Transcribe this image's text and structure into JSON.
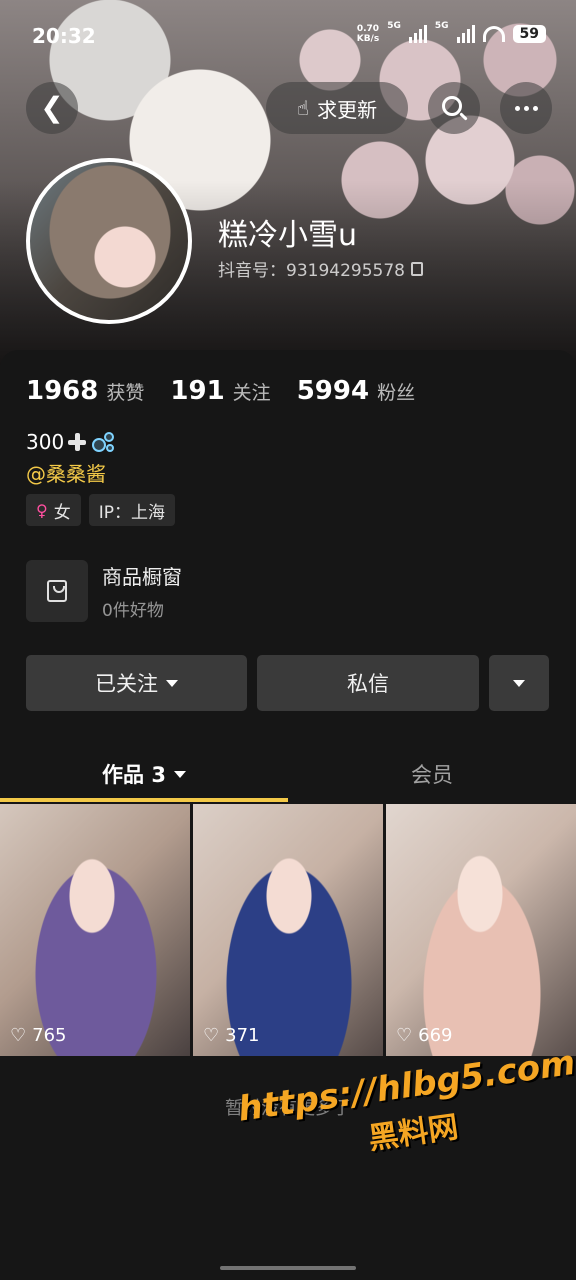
{
  "status_bar": {
    "time": "20:32",
    "net_speed_value": "0.70",
    "net_speed_unit": "KB/s",
    "signal_1": "5G",
    "signal_2": "5G",
    "battery": "59"
  },
  "header": {
    "update_label": "求更新",
    "icons": [
      "back-icon",
      "hand-pointing-icon",
      "search-icon",
      "more-icon"
    ]
  },
  "profile": {
    "nickname": "糕冷小雪u",
    "douyin_id": "抖音号：93194295578",
    "stats": [
      {
        "value": "1968",
        "label": "获赞"
      },
      {
        "value": "191",
        "label": "关注"
      },
      {
        "value": "5994",
        "label": "粉丝"
      }
    ],
    "bio_text": "300",
    "mention": "@桑桑酱",
    "tags": [
      {
        "label": "女",
        "icon": "female-icon"
      },
      {
        "label": "IP：上海"
      }
    ],
    "shop": {
      "title": "商品橱窗",
      "subtitle": "0件好物"
    }
  },
  "actions": {
    "follow_label": "已关注",
    "message_label": "私信"
  },
  "tabs": {
    "works_label": "作品 3",
    "members_label": "会员",
    "active": "works"
  },
  "videos": [
    {
      "likes": "765"
    },
    {
      "likes": "371"
    },
    {
      "likes": "669"
    }
  ],
  "footer_note": "暂时没有更多了",
  "watermark": {
    "line1": "https://hlbg5.com",
    "line2": "黑料网"
  },
  "colors": {
    "accent": "#f3c948",
    "background": "#161616",
    "button": "#3a3a3a",
    "female": "#ff4fa0"
  }
}
